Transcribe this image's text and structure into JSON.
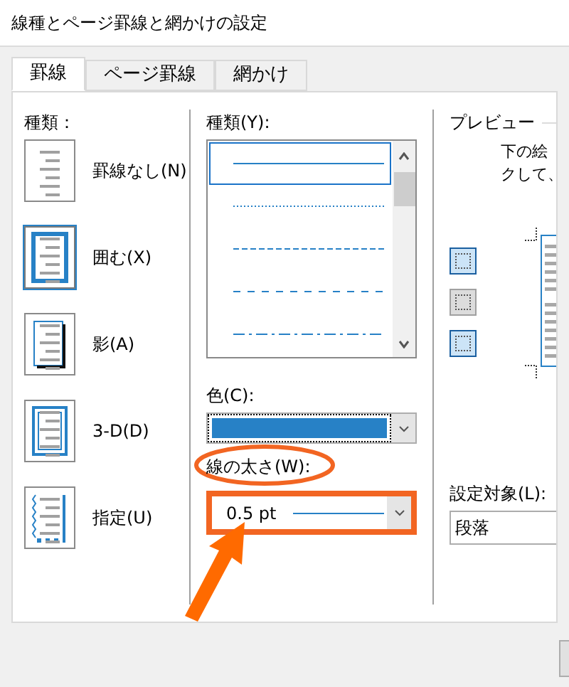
{
  "window": {
    "title": "線種とページ罫線と網かけの設定"
  },
  "tabs": [
    {
      "label": "罫線",
      "selected": true
    },
    {
      "label": "ページ罫線",
      "selected": false
    },
    {
      "label": "網かけ",
      "selected": false
    }
  ],
  "setting_types": {
    "label": "種類：",
    "items": [
      {
        "label": "罫線なし(N)",
        "kind": "none",
        "selected": false
      },
      {
        "label": "囲む(X)",
        "kind": "box",
        "selected": true
      },
      {
        "label": "影(A)",
        "kind": "shadow",
        "selected": false
      },
      {
        "label": "3-D(D)",
        "kind": "threed",
        "selected": false
      },
      {
        "label": "指定(U)",
        "kind": "custom",
        "selected": false
      }
    ]
  },
  "line_style": {
    "label": "種類(Y):",
    "items": [
      {
        "kind": "solid",
        "selected": true
      },
      {
        "kind": "dotted",
        "selected": false
      },
      {
        "kind": "dashed",
        "selected": false
      },
      {
        "kind": "wide-dashed",
        "selected": false
      },
      {
        "kind": "dash-dot",
        "selected": false
      }
    ]
  },
  "color_field": {
    "label": "色(C):",
    "color": "#2781c6"
  },
  "width_field": {
    "label": "線の太さ(W):",
    "value": "0.5 pt"
  },
  "preview": {
    "label": "プレビュー",
    "lines": [
      "下の絵",
      "クして、"
    ]
  },
  "apply_to": {
    "label": "設定対象(L):",
    "value": "段落"
  }
}
